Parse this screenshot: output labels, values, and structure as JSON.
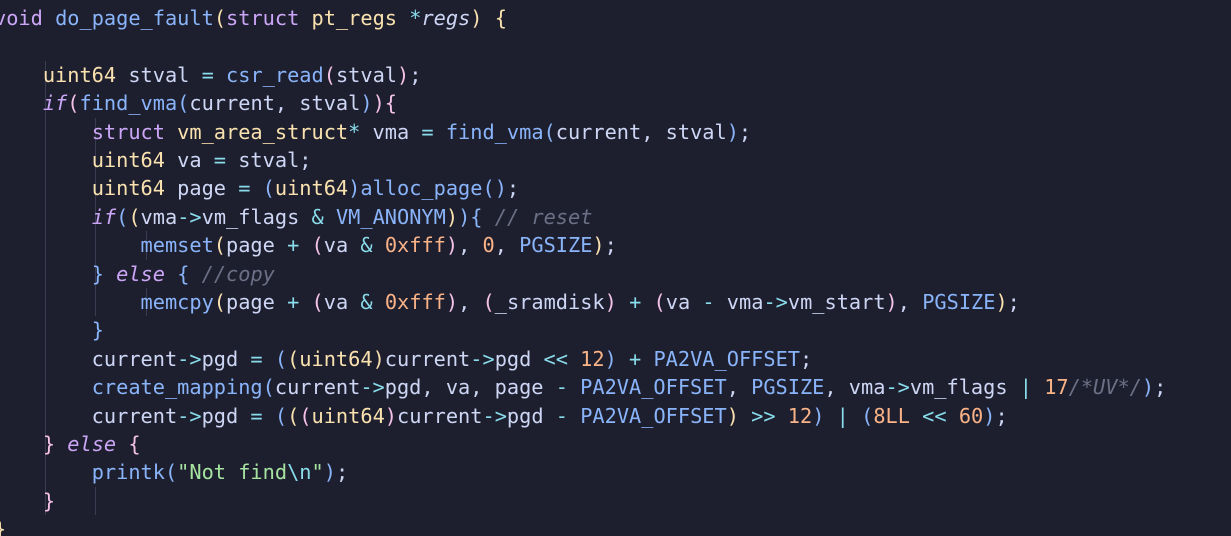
{
  "editor": {
    "colors": {
      "background": "#1e1f2e",
      "text": "#cdd6f4",
      "keyword": "#cba6f7",
      "type": "#f9e2af",
      "function": "#89b4fa",
      "number": "#fab387",
      "comment": "#6c7086",
      "string": "#a6e3a1",
      "operator": "#89dceb",
      "bracket_level1": "#f9e2af",
      "bracket_level2": "#f5c2e7",
      "bracket_level3": "#89b4fa",
      "indent_guide": "#3a3c52"
    },
    "lines": [
      {
        "tokens": [
          [
            "void",
            "keyword"
          ],
          [
            " ",
            "text"
          ],
          [
            "do_page_fault",
            "function"
          ],
          [
            "(",
            "bracket_level1"
          ],
          [
            "struct",
            "keyword"
          ],
          [
            " ",
            "text"
          ],
          [
            "pt_regs",
            "type"
          ],
          [
            " ",
            "text"
          ],
          [
            "*",
            "operator"
          ],
          [
            "regs",
            "param"
          ],
          [
            ")",
            "bracket_level1"
          ],
          [
            " ",
            "text"
          ],
          [
            "{",
            "bracket_level1"
          ]
        ]
      },
      {
        "tokens": []
      },
      {
        "tokens": [
          [
            "    ",
            "text"
          ],
          [
            "uint64",
            "type"
          ],
          [
            " stval ",
            "text"
          ],
          [
            "=",
            "operator"
          ],
          [
            " ",
            "text"
          ],
          [
            "csr_read",
            "function"
          ],
          [
            "(",
            "bracket_level2"
          ],
          [
            "stval",
            "text"
          ],
          [
            ")",
            "bracket_level2"
          ],
          [
            ";",
            "text"
          ]
        ]
      },
      {
        "tokens": [
          [
            "    ",
            "text"
          ],
          [
            "if",
            "keyword_italic"
          ],
          [
            "(",
            "bracket_level2"
          ],
          [
            "find_vma",
            "function"
          ],
          [
            "(",
            "bracket_level3"
          ],
          [
            "current, stval",
            "text"
          ],
          [
            ")",
            "bracket_level3"
          ],
          [
            ")",
            "bracket_level2"
          ],
          [
            "{",
            "bracket_level2"
          ]
        ]
      },
      {
        "tokens": [
          [
            "        ",
            "text"
          ],
          [
            "struct",
            "keyword"
          ],
          [
            " ",
            "text"
          ],
          [
            "vm_area_struct",
            "type"
          ],
          [
            "*",
            "operator"
          ],
          [
            " vma ",
            "text"
          ],
          [
            "=",
            "operator"
          ],
          [
            " ",
            "text"
          ],
          [
            "find_vma",
            "function"
          ],
          [
            "(",
            "bracket_level3"
          ],
          [
            "current, stval",
            "text"
          ],
          [
            ")",
            "bracket_level3"
          ],
          [
            ";",
            "text"
          ]
        ]
      },
      {
        "tokens": [
          [
            "        ",
            "text"
          ],
          [
            "uint64",
            "type"
          ],
          [
            " va ",
            "text"
          ],
          [
            "=",
            "operator"
          ],
          [
            " stval;",
            "text"
          ]
        ]
      },
      {
        "tokens": [
          [
            "        ",
            "text"
          ],
          [
            "uint64",
            "type"
          ],
          [
            " page ",
            "text"
          ],
          [
            "=",
            "operator"
          ],
          [
            " ",
            "text"
          ],
          [
            "(",
            "bracket_level3"
          ],
          [
            "uint64",
            "type"
          ],
          [
            ")",
            "bracket_level3"
          ],
          [
            "alloc_page",
            "function"
          ],
          [
            "(",
            "bracket_level3"
          ],
          [
            ")",
            "bracket_level3"
          ],
          [
            ";",
            "text"
          ]
        ]
      },
      {
        "tokens": [
          [
            "        ",
            "text"
          ],
          [
            "if",
            "keyword_italic"
          ],
          [
            "(",
            "bracket_level3"
          ],
          [
            "(",
            "bracket_level1"
          ],
          [
            "vma",
            "text"
          ],
          [
            "->",
            "operator"
          ],
          [
            "vm_flags ",
            "text"
          ],
          [
            "&",
            "operator"
          ],
          [
            " ",
            "text"
          ],
          [
            "VM_ANONYM",
            "function"
          ],
          [
            ")",
            "bracket_level1"
          ],
          [
            ")",
            "bracket_level3"
          ],
          [
            "{",
            "bracket_level3"
          ],
          [
            " ",
            "text"
          ],
          [
            "// reset",
            "comment"
          ]
        ]
      },
      {
        "tokens": [
          [
            "            ",
            "text"
          ],
          [
            "memset",
            "function"
          ],
          [
            "(",
            "bracket_level1"
          ],
          [
            "page ",
            "text"
          ],
          [
            "+",
            "operator"
          ],
          [
            " ",
            "text"
          ],
          [
            "(",
            "bracket_level2"
          ],
          [
            "va ",
            "text"
          ],
          [
            "&",
            "operator"
          ],
          [
            " ",
            "text"
          ],
          [
            "0xfff",
            "number"
          ],
          [
            ")",
            "bracket_level2"
          ],
          [
            ", ",
            "text"
          ],
          [
            "0",
            "number"
          ],
          [
            ", ",
            "text"
          ],
          [
            "PGSIZE",
            "function"
          ],
          [
            ")",
            "bracket_level1"
          ],
          [
            ";",
            "text"
          ]
        ]
      },
      {
        "tokens": [
          [
            "        ",
            "text"
          ],
          [
            "}",
            "bracket_level3"
          ],
          [
            " ",
            "text"
          ],
          [
            "else",
            "keyword_italic"
          ],
          [
            " ",
            "text"
          ],
          [
            "{",
            "bracket_level3"
          ],
          [
            " ",
            "text"
          ],
          [
            "//copy",
            "comment"
          ]
        ]
      },
      {
        "tokens": [
          [
            "            ",
            "text"
          ],
          [
            "memcpy",
            "function"
          ],
          [
            "(",
            "bracket_level1"
          ],
          [
            "page ",
            "text"
          ],
          [
            "+",
            "operator"
          ],
          [
            " ",
            "text"
          ],
          [
            "(",
            "bracket_level2"
          ],
          [
            "va ",
            "text"
          ],
          [
            "&",
            "operator"
          ],
          [
            " ",
            "text"
          ],
          [
            "0xfff",
            "number"
          ],
          [
            ")",
            "bracket_level2"
          ],
          [
            ", ",
            "text"
          ],
          [
            "(",
            "bracket_level2"
          ],
          [
            "_sramdisk",
            "text"
          ],
          [
            ")",
            "bracket_level2"
          ],
          [
            " ",
            "text"
          ],
          [
            "+",
            "operator"
          ],
          [
            " ",
            "text"
          ],
          [
            "(",
            "bracket_level2"
          ],
          [
            "va ",
            "text"
          ],
          [
            "-",
            "operator"
          ],
          [
            " vma",
            "text"
          ],
          [
            "->",
            "operator"
          ],
          [
            "vm_start",
            "text"
          ],
          [
            ")",
            "bracket_level2"
          ],
          [
            ", ",
            "text"
          ],
          [
            "PGSIZE",
            "function"
          ],
          [
            ")",
            "bracket_level1"
          ],
          [
            ";",
            "text"
          ]
        ]
      },
      {
        "tokens": [
          [
            "        ",
            "text"
          ],
          [
            "}",
            "bracket_level3"
          ]
        ]
      },
      {
        "tokens": [
          [
            "        current",
            "text"
          ],
          [
            "->",
            "operator"
          ],
          [
            "pgd ",
            "text"
          ],
          [
            "=",
            "operator"
          ],
          [
            " ",
            "text"
          ],
          [
            "(",
            "bracket_level3"
          ],
          [
            "(",
            "bracket_level1"
          ],
          [
            "uint64",
            "type"
          ],
          [
            ")",
            "bracket_level1"
          ],
          [
            "current",
            "text"
          ],
          [
            "->",
            "operator"
          ],
          [
            "pgd ",
            "text"
          ],
          [
            "<<",
            "operator"
          ],
          [
            " ",
            "text"
          ],
          [
            "12",
            "number"
          ],
          [
            ")",
            "bracket_level3"
          ],
          [
            " ",
            "text"
          ],
          [
            "+",
            "operator"
          ],
          [
            " ",
            "text"
          ],
          [
            "PA2VA_OFFSET",
            "function"
          ],
          [
            ";",
            "text"
          ]
        ]
      },
      {
        "tokens": [
          [
            "        ",
            "text"
          ],
          [
            "create_mapping",
            "function"
          ],
          [
            "(",
            "bracket_level3"
          ],
          [
            "current",
            "text"
          ],
          [
            "->",
            "operator"
          ],
          [
            "pgd, va, page ",
            "text"
          ],
          [
            "-",
            "operator"
          ],
          [
            " ",
            "text"
          ],
          [
            "PA2VA_OFFSET",
            "function"
          ],
          [
            ", ",
            "text"
          ],
          [
            "PGSIZE",
            "function"
          ],
          [
            ", vma",
            "text"
          ],
          [
            "->",
            "operator"
          ],
          [
            "vm_flags ",
            "text"
          ],
          [
            "|",
            "operator"
          ],
          [
            " ",
            "text"
          ],
          [
            "17",
            "number"
          ],
          [
            "/*UV*/",
            "comment"
          ],
          [
            ")",
            "bracket_level3"
          ],
          [
            ";",
            "text"
          ]
        ]
      },
      {
        "tokens": [
          [
            "        current",
            "text"
          ],
          [
            "->",
            "operator"
          ],
          [
            "pgd ",
            "text"
          ],
          [
            "=",
            "operator"
          ],
          [
            " ",
            "text"
          ],
          [
            "(",
            "bracket_level3"
          ],
          [
            "(",
            "bracket_level1"
          ],
          [
            "(",
            "bracket_level2"
          ],
          [
            "uint64",
            "type"
          ],
          [
            ")",
            "bracket_level2"
          ],
          [
            "current",
            "text"
          ],
          [
            "->",
            "operator"
          ],
          [
            "pgd ",
            "text"
          ],
          [
            "-",
            "operator"
          ],
          [
            " ",
            "text"
          ],
          [
            "PA2VA_OFFSET",
            "function"
          ],
          [
            ")",
            "bracket_level1"
          ],
          [
            " ",
            "text"
          ],
          [
            ">>",
            "operator"
          ],
          [
            " ",
            "text"
          ],
          [
            "12",
            "number"
          ],
          [
            ")",
            "bracket_level3"
          ],
          [
            " ",
            "text"
          ],
          [
            "|",
            "operator"
          ],
          [
            " ",
            "text"
          ],
          [
            "(",
            "bracket_level3"
          ],
          [
            "8LL",
            "number"
          ],
          [
            " ",
            "text"
          ],
          [
            "<<",
            "operator"
          ],
          [
            " ",
            "text"
          ],
          [
            "60",
            "number"
          ],
          [
            ")",
            "bracket_level3"
          ],
          [
            ";",
            "text"
          ]
        ]
      },
      {
        "tokens": [
          [
            "    ",
            "text"
          ],
          [
            "}",
            "bracket_level2"
          ],
          [
            " ",
            "text"
          ],
          [
            "else",
            "keyword_italic"
          ],
          [
            " ",
            "text"
          ],
          [
            "{",
            "bracket_level2"
          ]
        ]
      },
      {
        "tokens": [
          [
            "        ",
            "text"
          ],
          [
            "printk",
            "function"
          ],
          [
            "(",
            "bracket_level3"
          ],
          [
            "\"Not find",
            "string"
          ],
          [
            "\\n",
            "operator"
          ],
          [
            "\"",
            "string"
          ],
          [
            ")",
            "bracket_level3"
          ],
          [
            ";",
            "text"
          ]
        ]
      },
      {
        "tokens": [
          [
            "    ",
            "text"
          ],
          [
            "}",
            "bracket_level2"
          ]
        ]
      },
      {
        "tokens": [
          [
            "}",
            "bracket_level1"
          ]
        ]
      }
    ]
  }
}
